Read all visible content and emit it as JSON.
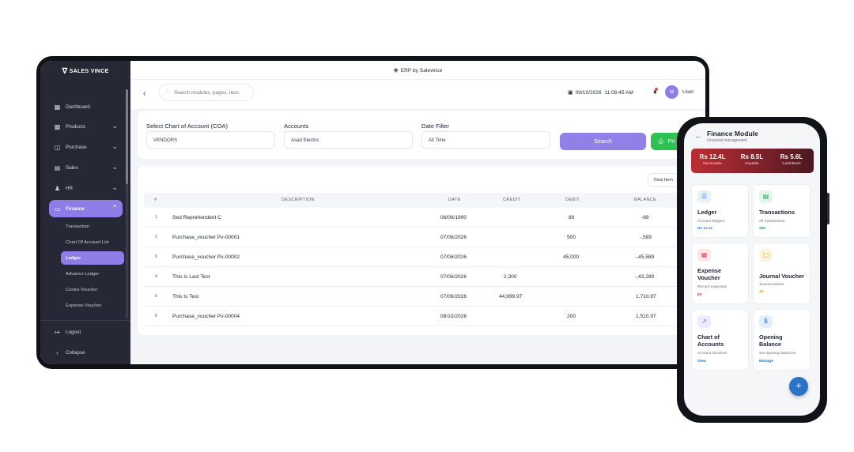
{
  "app": {
    "brand": "SALES VINCE",
    "window_title": "ERP by Salevince"
  },
  "sidebar": {
    "items": [
      {
        "label": "Dashboard",
        "icon": "dashboard-icon"
      },
      {
        "label": "Products",
        "icon": "box-icon"
      },
      {
        "label": "Purchase",
        "icon": "cart-icon"
      },
      {
        "label": "Sales",
        "icon": "chart-icon"
      },
      {
        "label": "HR",
        "icon": "people-icon"
      },
      {
        "label": "Finance",
        "icon": "wallet-icon"
      }
    ],
    "finance_sub": [
      "Transaction",
      "Chart Of Account List",
      "Ledger",
      "Advance Ledger",
      "Contra Voucher",
      "Expense Voucher"
    ],
    "logout": "Logout",
    "collapse": "Collapse"
  },
  "header": {
    "search_placeholder": "Search modules, pages, reco",
    "date": "09/10/2026",
    "time": "11:08:45 AM",
    "user_initial": "U",
    "user_name": "User"
  },
  "filters": {
    "coa_label": "Select Chart of Account (COA)",
    "coa_value": "VENDORS",
    "accounts_label": "Accounts",
    "accounts_value": "Asad Electric",
    "date_label": "Date Filter",
    "date_value": "All Time",
    "search_button": "Search",
    "print_button": "Pri"
  },
  "table": {
    "total_items": "Total Item",
    "headers": [
      "#",
      "DESCRIPTION",
      "DATE",
      "CREDIT",
      "DEBIT",
      "BALANCE"
    ],
    "rows": [
      {
        "idx": "1",
        "description": "Sed Reprehenderit C",
        "date": "06/06/1990",
        "credit": "",
        "debit": "89",
        "balance": "-89"
      },
      {
        "idx": "2",
        "description": "Purchase_voucher Pv-00001",
        "date": "07/06/2026",
        "credit": "",
        "debit": "500",
        "balance": "-,589"
      },
      {
        "idx": "3",
        "description": "Purchase_voucher Pv-00002",
        "date": "07/06/2026",
        "credit": "",
        "debit": "45,000",
        "balance": "-,45,589"
      },
      {
        "idx": "4",
        "description": "This Is Last Test",
        "date": "07/06/2026",
        "credit": "2,300",
        "debit": "",
        "balance": "-,43,289"
      },
      {
        "idx": "5",
        "description": "This Is Test",
        "date": "07/06/2026",
        "credit": "44,999.97",
        "debit": "",
        "balance": "1,710.97"
      },
      {
        "idx": "6",
        "description": "Purchase_voucher Pv-00004",
        "date": "08/10/2026",
        "credit": "",
        "debit": "200",
        "balance": "1,510.97"
      }
    ]
  },
  "mobile": {
    "title": "Finance Module",
    "subtitle": "Financial management",
    "stats": [
      {
        "value": "Rs 12.4L",
        "label": "Receivable"
      },
      {
        "value": "Rs 8.5L",
        "label": "Payable"
      },
      {
        "value": "Rs 5.6L",
        "label": "Cash/Bank"
      }
    ],
    "tiles": [
      {
        "title": "Ledger",
        "desc": "Account ledgers",
        "meta": "Rs 12.4L",
        "icon": "book-icon",
        "color": "#3b82f6"
      },
      {
        "title": "Transactions",
        "desc": "All transactions",
        "meta": "456",
        "icon": "document-icon",
        "color": "#22a35a"
      },
      {
        "title": "Expense Voucher",
        "desc": "Record expenses",
        "meta": "89",
        "icon": "receipt-icon",
        "color": "#e5484d"
      },
      {
        "title": "Journal Voucher",
        "desc": "Journal entries",
        "meta": "45",
        "icon": "file-icon",
        "color": "#f59e0b"
      },
      {
        "title": "Chart of Accounts",
        "desc": "Account structure",
        "meta": "View",
        "icon": "trend-icon",
        "color": "#8b5cf6"
      },
      {
        "title": "Opening Balance",
        "desc": "Set opening balances",
        "meta": "Manage",
        "icon": "dollar-icon",
        "color": "#2a73c9"
      }
    ],
    "fab": "+"
  }
}
